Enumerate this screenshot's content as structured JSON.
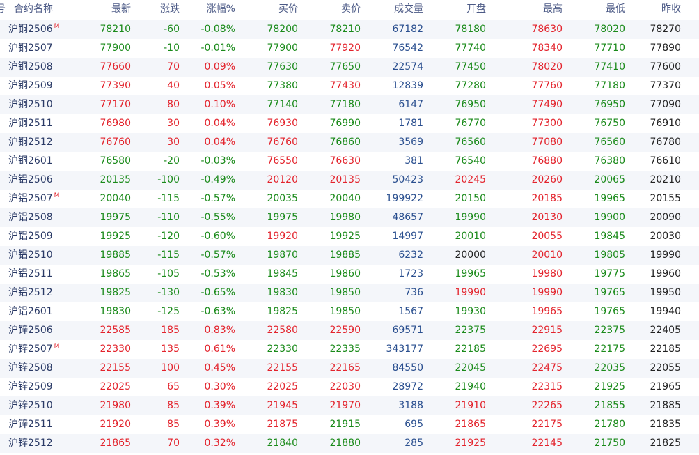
{
  "header": {
    "idx": "号",
    "name": "合约名称",
    "last": "最新",
    "chg": "涨跌",
    "pct": "涨幅%",
    "bid": "买价",
    "ask": "卖价",
    "vol": "成交量",
    "open": "开盘",
    "high": "最高",
    "low": "最低",
    "prev": "昨收"
  },
  "main_marker": "M",
  "colors": {
    "up": "#e3232c",
    "down": "#1a8a1a",
    "volume": "#2a4f8f",
    "flat": "#222222"
  },
  "rows": [
    {
      "name": "沪铜2506",
      "main": true,
      "last": "78210",
      "chg": "-60",
      "pct": "-0.08%",
      "bid": "78200",
      "ask": "78210",
      "vol": "67182",
      "open": "78180",
      "high": "78630",
      "low": "78020",
      "prev": "78270",
      "c": {
        "last": "green",
        "chg": "green",
        "pct": "green",
        "bid": "green",
        "ask": "green",
        "open": "green",
        "high": "red",
        "low": "green"
      }
    },
    {
      "name": "沪铜2507",
      "main": false,
      "last": "77900",
      "chg": "-10",
      "pct": "-0.01%",
      "bid": "77900",
      "ask": "77920",
      "vol": "76542",
      "open": "77740",
      "high": "78340",
      "low": "77710",
      "prev": "77890",
      "c": {
        "last": "green",
        "chg": "green",
        "pct": "green",
        "bid": "green",
        "ask": "red",
        "open": "green",
        "high": "red",
        "low": "green"
      }
    },
    {
      "name": "沪铜2508",
      "main": false,
      "last": "77660",
      "chg": "70",
      "pct": "0.09%",
      "bid": "77630",
      "ask": "77650",
      "vol": "22574",
      "open": "77450",
      "high": "78020",
      "low": "77410",
      "prev": "77600",
      "c": {
        "last": "red",
        "chg": "red",
        "pct": "red",
        "bid": "green",
        "ask": "green",
        "open": "green",
        "high": "red",
        "low": "green"
      }
    },
    {
      "name": "沪铜2509",
      "main": false,
      "last": "77390",
      "chg": "40",
      "pct": "0.05%",
      "bid": "77380",
      "ask": "77430",
      "vol": "12839",
      "open": "77280",
      "high": "77760",
      "low": "77180",
      "prev": "77370",
      "c": {
        "last": "red",
        "chg": "red",
        "pct": "red",
        "bid": "green",
        "ask": "red",
        "open": "green",
        "high": "red",
        "low": "green"
      }
    },
    {
      "name": "沪铜2510",
      "main": false,
      "last": "77170",
      "chg": "80",
      "pct": "0.10%",
      "bid": "77140",
      "ask": "77180",
      "vol": "6147",
      "open": "76950",
      "high": "77490",
      "low": "76950",
      "prev": "77090",
      "c": {
        "last": "red",
        "chg": "red",
        "pct": "red",
        "bid": "green",
        "ask": "green",
        "open": "green",
        "high": "red",
        "low": "green"
      }
    },
    {
      "name": "沪铜2511",
      "main": false,
      "last": "76980",
      "chg": "30",
      "pct": "0.04%",
      "bid": "76930",
      "ask": "76990",
      "vol": "1781",
      "open": "76770",
      "high": "77300",
      "low": "76750",
      "prev": "76910",
      "c": {
        "last": "red",
        "chg": "red",
        "pct": "red",
        "bid": "red",
        "ask": "green",
        "open": "green",
        "high": "red",
        "low": "green"
      }
    },
    {
      "name": "沪铜2512",
      "main": false,
      "last": "76760",
      "chg": "30",
      "pct": "0.04%",
      "bid": "76760",
      "ask": "76860",
      "vol": "3569",
      "open": "76560",
      "high": "77080",
      "low": "76560",
      "prev": "76780",
      "c": {
        "last": "red",
        "chg": "red",
        "pct": "red",
        "bid": "red",
        "ask": "green",
        "open": "green",
        "high": "red",
        "low": "green"
      }
    },
    {
      "name": "沪铜2601",
      "main": false,
      "last": "76580",
      "chg": "-20",
      "pct": "-0.03%",
      "bid": "76550",
      "ask": "76630",
      "vol": "381",
      "open": "76540",
      "high": "76880",
      "low": "76380",
      "prev": "76610",
      "c": {
        "last": "green",
        "chg": "green",
        "pct": "green",
        "bid": "red",
        "ask": "red",
        "open": "green",
        "high": "red",
        "low": "green"
      }
    },
    {
      "name": "沪铝2506",
      "main": false,
      "last": "20135",
      "chg": "-100",
      "pct": "-0.49%",
      "bid": "20120",
      "ask": "20135",
      "vol": "50423",
      "open": "20245",
      "high": "20260",
      "low": "20065",
      "prev": "20210",
      "c": {
        "last": "green",
        "chg": "green",
        "pct": "green",
        "bid": "red",
        "ask": "red",
        "open": "red",
        "high": "red",
        "low": "green"
      }
    },
    {
      "name": "沪铝2507",
      "main": true,
      "last": "20040",
      "chg": "-115",
      "pct": "-0.57%",
      "bid": "20035",
      "ask": "20040",
      "vol": "199922",
      "open": "20150",
      "high": "20185",
      "low": "19965",
      "prev": "20155",
      "c": {
        "last": "green",
        "chg": "green",
        "pct": "green",
        "bid": "green",
        "ask": "green",
        "open": "green",
        "high": "red",
        "low": "green"
      }
    },
    {
      "name": "沪铝2508",
      "main": false,
      "last": "19975",
      "chg": "-110",
      "pct": "-0.55%",
      "bid": "19975",
      "ask": "19980",
      "vol": "48657",
      "open": "19990",
      "high": "20130",
      "low": "19900",
      "prev": "20090",
      "c": {
        "last": "green",
        "chg": "green",
        "pct": "green",
        "bid": "green",
        "ask": "green",
        "open": "green",
        "high": "red",
        "low": "green"
      }
    },
    {
      "name": "沪铝2509",
      "main": false,
      "last": "19925",
      "chg": "-120",
      "pct": "-0.60%",
      "bid": "19920",
      "ask": "19925",
      "vol": "14997",
      "open": "20010",
      "high": "20055",
      "low": "19845",
      "prev": "20030",
      "c": {
        "last": "green",
        "chg": "green",
        "pct": "green",
        "bid": "red",
        "ask": "green",
        "open": "green",
        "high": "red",
        "low": "green"
      }
    },
    {
      "name": "沪铝2510",
      "main": false,
      "last": "19885",
      "chg": "-115",
      "pct": "-0.57%",
      "bid": "19870",
      "ask": "19885",
      "vol": "6232",
      "open": "20000",
      "high": "20010",
      "low": "19805",
      "prev": "19990",
      "c": {
        "last": "green",
        "chg": "green",
        "pct": "green",
        "bid": "green",
        "ask": "green",
        "open": "black",
        "high": "red",
        "low": "green"
      }
    },
    {
      "name": "沪铝2511",
      "main": false,
      "last": "19865",
      "chg": "-105",
      "pct": "-0.53%",
      "bid": "19845",
      "ask": "19860",
      "vol": "1723",
      "open": "19965",
      "high": "19980",
      "low": "19775",
      "prev": "19960",
      "c": {
        "last": "green",
        "chg": "green",
        "pct": "green",
        "bid": "green",
        "ask": "green",
        "open": "green",
        "high": "red",
        "low": "green"
      }
    },
    {
      "name": "沪铝2512",
      "main": false,
      "last": "19825",
      "chg": "-130",
      "pct": "-0.65%",
      "bid": "19830",
      "ask": "19850",
      "vol": "736",
      "open": "19990",
      "high": "19990",
      "low": "19765",
      "prev": "19950",
      "c": {
        "last": "green",
        "chg": "green",
        "pct": "green",
        "bid": "green",
        "ask": "green",
        "open": "red",
        "high": "red",
        "low": "green"
      }
    },
    {
      "name": "沪铝2601",
      "main": false,
      "last": "19830",
      "chg": "-125",
      "pct": "-0.63%",
      "bid": "19825",
      "ask": "19850",
      "vol": "1567",
      "open": "19930",
      "high": "19965",
      "low": "19765",
      "prev": "19940",
      "c": {
        "last": "green",
        "chg": "green",
        "pct": "green",
        "bid": "green",
        "ask": "green",
        "open": "green",
        "high": "red",
        "low": "green"
      }
    },
    {
      "name": "沪锌2506",
      "main": false,
      "last": "22585",
      "chg": "185",
      "pct": "0.83%",
      "bid": "22580",
      "ask": "22590",
      "vol": "69571",
      "open": "22375",
      "high": "22915",
      "low": "22375",
      "prev": "22405",
      "c": {
        "last": "red",
        "chg": "red",
        "pct": "red",
        "bid": "red",
        "ask": "red",
        "open": "green",
        "high": "red",
        "low": "green"
      }
    },
    {
      "name": "沪锌2507",
      "main": true,
      "last": "22330",
      "chg": "135",
      "pct": "0.61%",
      "bid": "22330",
      "ask": "22335",
      "vol": "343177",
      "open": "22185",
      "high": "22695",
      "low": "22175",
      "prev": "22185",
      "c": {
        "last": "red",
        "chg": "red",
        "pct": "red",
        "bid": "green",
        "ask": "green",
        "open": "green",
        "high": "red",
        "low": "green"
      }
    },
    {
      "name": "沪锌2508",
      "main": false,
      "last": "22155",
      "chg": "100",
      "pct": "0.45%",
      "bid": "22155",
      "ask": "22165",
      "vol": "84550",
      "open": "22045",
      "high": "22475",
      "low": "22035",
      "prev": "22055",
      "c": {
        "last": "red",
        "chg": "red",
        "pct": "red",
        "bid": "red",
        "ask": "red",
        "open": "green",
        "high": "red",
        "low": "green"
      }
    },
    {
      "name": "沪锌2509",
      "main": false,
      "last": "22025",
      "chg": "65",
      "pct": "0.30%",
      "bid": "22025",
      "ask": "22030",
      "vol": "28972",
      "open": "21940",
      "high": "22315",
      "low": "21925",
      "prev": "21965",
      "c": {
        "last": "red",
        "chg": "red",
        "pct": "red",
        "bid": "red",
        "ask": "red",
        "open": "green",
        "high": "red",
        "low": "green"
      }
    },
    {
      "name": "沪锌2510",
      "main": false,
      "last": "21980",
      "chg": "85",
      "pct": "0.39%",
      "bid": "21945",
      "ask": "21970",
      "vol": "3188",
      "open": "21910",
      "high": "22265",
      "low": "21855",
      "prev": "21885",
      "c": {
        "last": "red",
        "chg": "red",
        "pct": "red",
        "bid": "red",
        "ask": "red",
        "open": "red",
        "high": "red",
        "low": "green"
      }
    },
    {
      "name": "沪锌2511",
      "main": false,
      "last": "21920",
      "chg": "85",
      "pct": "0.39%",
      "bid": "21875",
      "ask": "21915",
      "vol": "695",
      "open": "21865",
      "high": "22175",
      "low": "21780",
      "prev": "21835",
      "c": {
        "last": "red",
        "chg": "red",
        "pct": "red",
        "bid": "red",
        "ask": "green",
        "open": "red",
        "high": "red",
        "low": "green"
      }
    },
    {
      "name": "沪锌2512",
      "main": false,
      "last": "21865",
      "chg": "70",
      "pct": "0.32%",
      "bid": "21840",
      "ask": "21880",
      "vol": "285",
      "open": "21925",
      "high": "22145",
      "low": "21750",
      "prev": "21825",
      "c": {
        "last": "red",
        "chg": "red",
        "pct": "red",
        "bid": "green",
        "ask": "green",
        "open": "red",
        "high": "red",
        "low": "green"
      }
    }
  ]
}
